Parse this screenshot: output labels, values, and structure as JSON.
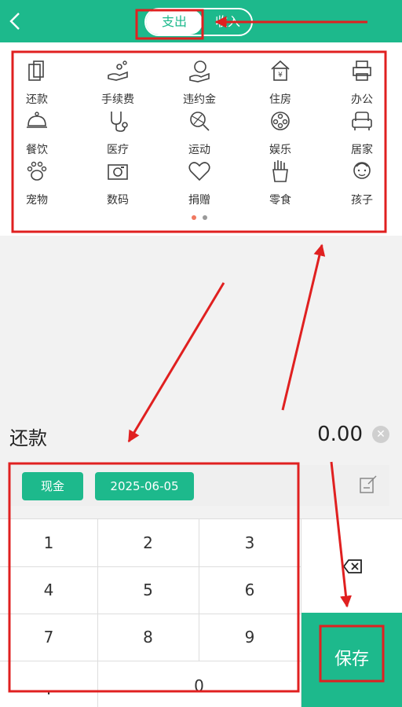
{
  "header": {
    "expense_tab": "支出",
    "income_tab": "收入"
  },
  "categories": [
    {
      "label": "还款",
      "icon": "repayment-icon"
    },
    {
      "label": "手续费",
      "icon": "fee-icon"
    },
    {
      "label": "违约金",
      "icon": "penalty-icon"
    },
    {
      "label": "住房",
      "icon": "housing-icon"
    },
    {
      "label": "办公",
      "icon": "office-icon"
    },
    {
      "label": "餐饮",
      "icon": "dining-icon"
    },
    {
      "label": "医疗",
      "icon": "medical-icon"
    },
    {
      "label": "运动",
      "icon": "sports-icon"
    },
    {
      "label": "娱乐",
      "icon": "entertainment-icon"
    },
    {
      "label": "居家",
      "icon": "home-icon"
    },
    {
      "label": "宠物",
      "icon": "pet-icon"
    },
    {
      "label": "数码",
      "icon": "digital-icon"
    },
    {
      "label": "捐赠",
      "icon": "donation-icon"
    },
    {
      "label": "零食",
      "icon": "snack-icon"
    },
    {
      "label": "孩子",
      "icon": "child-icon"
    }
  ],
  "selected_category": "还款",
  "amount": "0.00",
  "account": "现金",
  "date": "2025-06-05",
  "keypad": {
    "k1": "1",
    "k2": "2",
    "k3": "3",
    "k4": "4",
    "k5": "5",
    "k6": "6",
    "k7": "7",
    "k8": "8",
    "k9": "9",
    "dot": ".",
    "k0": "0"
  },
  "save_label": "保存",
  "colors": {
    "accent": "#1db98c",
    "annotation": "#e02020",
    "page_dot_active": "#f07860",
    "page_dot_inactive": "#999999"
  }
}
